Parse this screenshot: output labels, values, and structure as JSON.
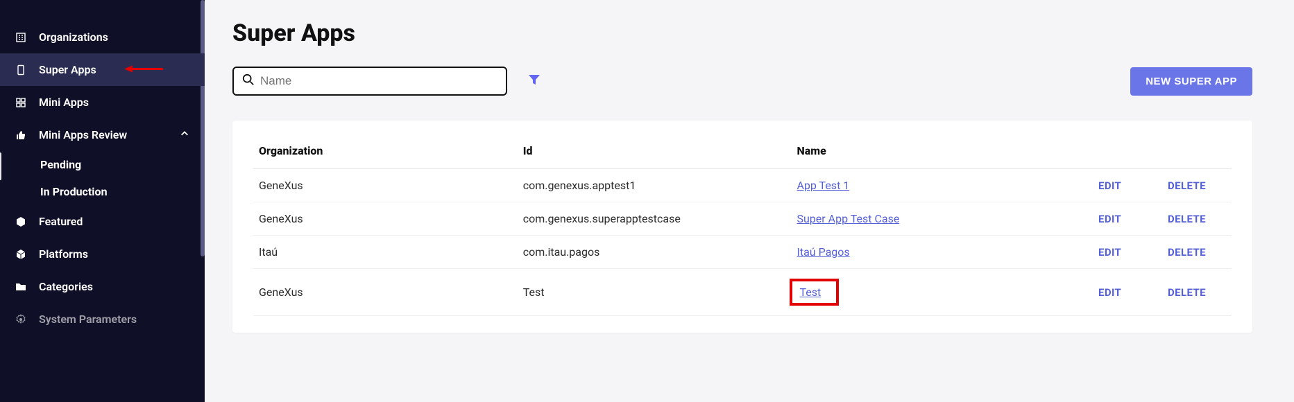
{
  "sidebar": {
    "items": [
      {
        "label": "Organizations",
        "icon": "building-icon"
      },
      {
        "label": "Super Apps",
        "icon": "device-icon",
        "active": true,
        "annotated": true
      },
      {
        "label": "Mini Apps",
        "icon": "grid-icon"
      },
      {
        "label": "Mini Apps Review",
        "icon": "thumb-icon",
        "expanded": true,
        "children": [
          {
            "label": "Pending"
          },
          {
            "label": "In Production"
          }
        ]
      },
      {
        "label": "Featured",
        "icon": "hexagon-icon"
      },
      {
        "label": "Platforms",
        "icon": "cube-icon"
      },
      {
        "label": "Categories",
        "icon": "folder-icon"
      },
      {
        "label": "System Parameters",
        "icon": "gear-icon"
      }
    ]
  },
  "page": {
    "title": "Super Apps",
    "search_placeholder": "Name",
    "new_button": "NEW SUPER APP"
  },
  "table": {
    "headers": {
      "org": "Organization",
      "id": "Id",
      "name": "Name"
    },
    "actions": {
      "edit": "EDIT",
      "delete": "DELETE"
    },
    "rows": [
      {
        "org": "GeneXus",
        "id": "com.genexus.apptest1",
        "name": "App Test 1",
        "highlighted": false
      },
      {
        "org": "GeneXus",
        "id": "com.genexus.superapptestcase",
        "name": "Super App Test Case",
        "highlighted": false
      },
      {
        "org": "Itaú",
        "id": "com.itau.pagos",
        "name": "Itaú Pagos",
        "highlighted": false
      },
      {
        "org": "GeneXus",
        "id": "Test",
        "name": "Test",
        "highlighted": true
      }
    ]
  },
  "colors": {
    "accent": "#6366f1",
    "annotation": "#e30000"
  }
}
